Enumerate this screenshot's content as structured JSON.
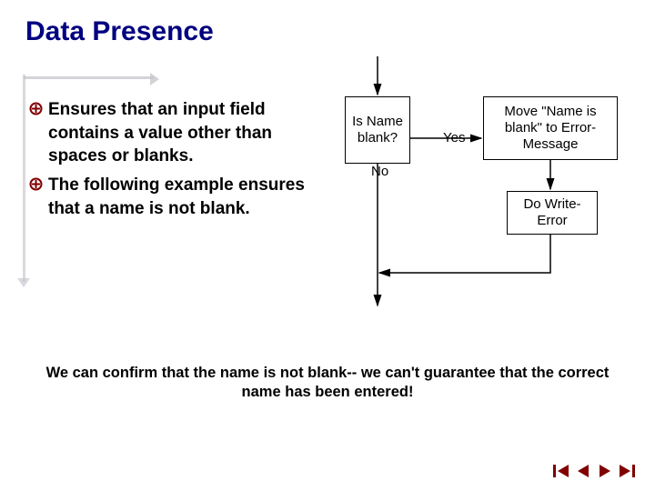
{
  "title": "Data Presence",
  "bullets": [
    "Ensures that an input field contains a value other than spaces or blanks.",
    "The following example ensures that a name is not blank."
  ],
  "flow": {
    "decision": "Is Name blank?",
    "yes_label": "Yes",
    "no_label": "No",
    "process1": "Move \"Name is blank\" to Error-Message",
    "process2": "Do Write-Error"
  },
  "footnote": "We can confirm that the name is not blank-- we can't guarantee that the correct name has been entered!",
  "colors": {
    "title": "#000080",
    "nav_arrow": "#800000"
  }
}
